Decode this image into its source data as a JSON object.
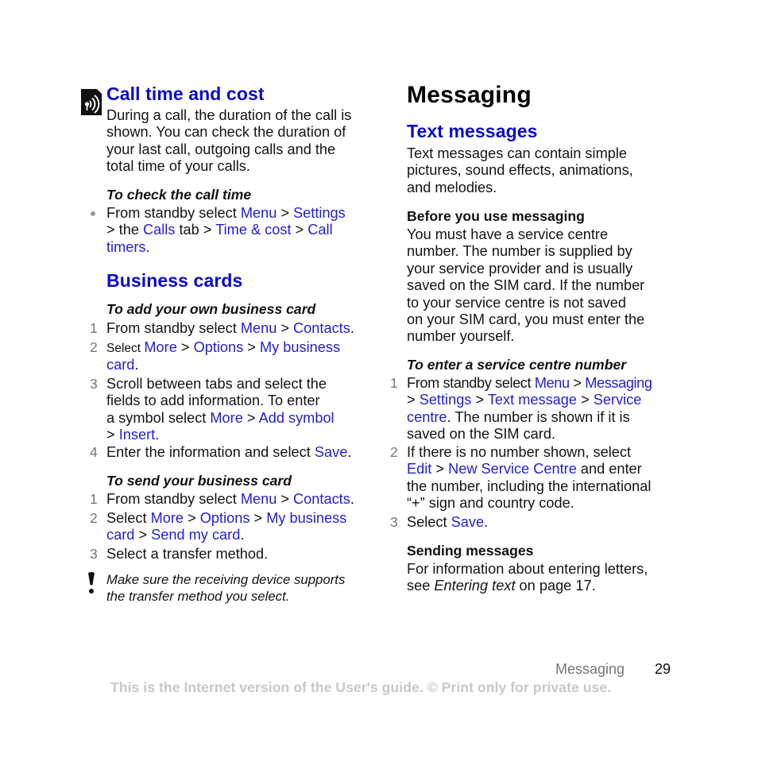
{
  "left": {
    "call_time": {
      "icon": "speaker-antenna-icon",
      "title": "Call time and cost",
      "para": [
        "During a call, the duration of the call is",
        "shown. You can check the duration of",
        "your last call, outgoing calls and the",
        "total time of your calls."
      ],
      "check_heading": "To check the call time",
      "bullet": {
        "l1_a": "From standby select ",
        "l1_menu": "Menu",
        "l1_sep": " > ",
        "l1_settings": "Settings",
        "l2_a": "> the ",
        "l2_calls": "Calls",
        "l2_b": " tab > ",
        "l2_timecost": "Time & cost",
        "l2_c": " > ",
        "l2_call": "Call",
        "l3_timers": "timers",
        "l3_end": "."
      }
    },
    "business_cards": {
      "title": "Business cards",
      "add_heading": "To add your own business card",
      "add_steps": {
        "s1": {
          "num": "1",
          "a": "From standby select ",
          "menu": "Menu",
          "sep": " > ",
          "contacts": "Contacts",
          "end": "."
        },
        "s2": {
          "num": "2",
          "a": "Select ",
          "more": "More",
          "sep1": " > ",
          "options": "Options",
          "sep2": " > ",
          "mybusiness": "My business",
          "card": "card",
          "end": "."
        },
        "s3": {
          "num": "3",
          "l1": "Scroll between tabs and select the",
          "l2": "fields to add information. To enter",
          "l3_a": "a symbol select ",
          "more": "More",
          "sep": " > ",
          "addsymbol": "Add symbol",
          "l4_a": "> ",
          "insert": "Insert",
          "end": "."
        },
        "s4": {
          "num": "4",
          "a": "Enter the information and select ",
          "save": "Save",
          "end": "."
        }
      },
      "send_heading": "To send your business card",
      "send_steps": {
        "s1": {
          "num": "1",
          "a": "From standby select ",
          "menu": "Menu",
          "sep": " > ",
          "contacts": "Contacts",
          "end": "."
        },
        "s2": {
          "num": "2",
          "a": "Select ",
          "more": "More",
          "sep1": " > ",
          "options": "Options",
          "sep2": " > ",
          "mybusiness": "My business",
          "card": "card",
          "sep3": " > ",
          "sendmycard": "Send my card",
          "end": "."
        },
        "s3": {
          "num": "3",
          "a": "Select a transfer method."
        }
      },
      "note": {
        "icon": "exclamation-icon",
        "l1": "Make sure the receiving device supports",
        "l2": "the transfer method you select."
      }
    }
  },
  "right": {
    "chapter_title": "Messaging",
    "section_title": "Text messages",
    "intro": [
      "Text messages can contain simple",
      "pictures, sound effects, animations,",
      "and melodies."
    ],
    "before_heading": "Before you use messaging",
    "before_para": [
      "You must have a service centre",
      "number. The number is supplied by",
      "your service provider and is usually",
      "saved on the SIM card. If the number",
      "to your service centre is not saved",
      "on your SIM card, you must enter the",
      "number yourself."
    ],
    "enter_heading": "To enter a service centre number",
    "enter_steps": {
      "s1": {
        "num": "1",
        "a": "From standby select ",
        "menu": "Menu",
        "sep1": " > ",
        "messaging": "Messaging",
        "l2_a": "> ",
        "settings": "Settings",
        "sep2": " > ",
        "textmessage": "Text message",
        "sep3": " > ",
        "service": "Service",
        "centre": "centre",
        "l3_b": ". The number is shown if it is",
        "l4": "saved on the SIM card."
      },
      "s2": {
        "num": "2",
        "l1": "If there is no number shown, select",
        "edit": "Edit",
        "sep": " > ",
        "newservice": "New Service Centre",
        "l2_b": " and enter",
        "l3": "the number, including the international",
        "l4": "“+” sign and country code."
      },
      "s3": {
        "num": "3",
        "a": "Select ",
        "save": "Save",
        "end": "."
      }
    },
    "sending_heading": "Sending messages",
    "sending_l1": "For information about entering letters,",
    "sending_l2_a": "see ",
    "sending_l2_em": "Entering text",
    "sending_l2_b": " on page 17."
  },
  "footer": {
    "section": "Messaging",
    "page": "29",
    "disclaimer": "This is the Internet version of the User's guide. © Print only for private use."
  },
  "colors": {
    "link": "#1f1fdc",
    "heading_blue": "#0a0acc",
    "disclaimer": "#c8c8c8"
  }
}
